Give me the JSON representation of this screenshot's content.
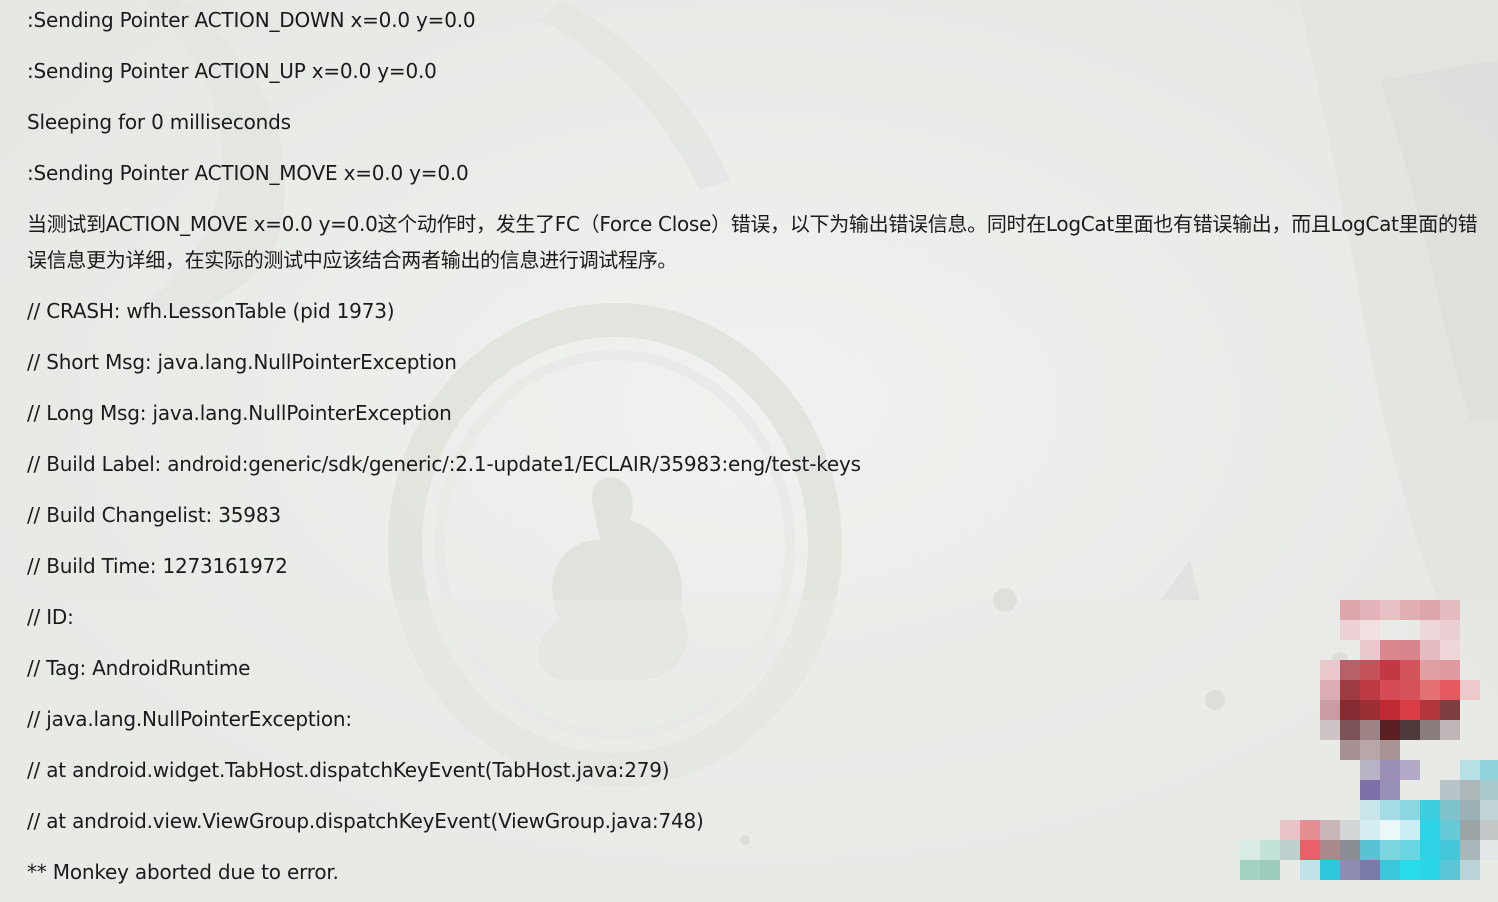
{
  "log": {
    "line1": ":Sending Pointer ACTION_DOWN x=0.0 y=0.0",
    "line2": ":Sending Pointer ACTION_UP x=0.0 y=0.0",
    "line3": "Sleeping for 0 milliseconds",
    "line4": ":Sending Pointer ACTION_MOVE x=0.0 y=0.0",
    "description": "当测试到ACTION_MOVE x=0.0 y=0.0这个动作时，发生了FC（Force Close）错误，以下为输出错误信息。同时在LogCat里面也有错误输出，而且LogCat里面的错误信息更为详细，在实际的测试中应该结合两者输出的信息进行调试程序。",
    "crash": "// CRASH: wfh.LessonTable (pid 1973)",
    "short_msg": "// Short Msg: java.lang.NullPointerException",
    "long_msg": "// Long Msg: java.lang.NullPointerException",
    "build_label": "// Build Label: android:generic/sdk/generic/:2.1-update1/ECLAIR/35983:eng/test-keys",
    "build_changelist": "// Build Changelist: 35983",
    "build_time": "// Build Time: 1273161972",
    "id": "// ID:",
    "tag": "// Tag: AndroidRuntime",
    "exception": "// java.lang.NullPointerException:",
    "stack1": "//   at android.widget.TabHost.dispatchKeyEvent(TabHost.java:279)",
    "stack2": "//   at android.view.ViewGroup.dispatchKeyEvent(ViewGroup.java:748)",
    "aborted": "** Monkey aborted due to error."
  },
  "colors": {
    "background": "#eceeeb",
    "text": "#1b1b1b"
  },
  "decorations": {
    "background_image": "faded-seashore-sculpture-illustration",
    "corner_avatar": "pixelated-mascot-avatar"
  }
}
